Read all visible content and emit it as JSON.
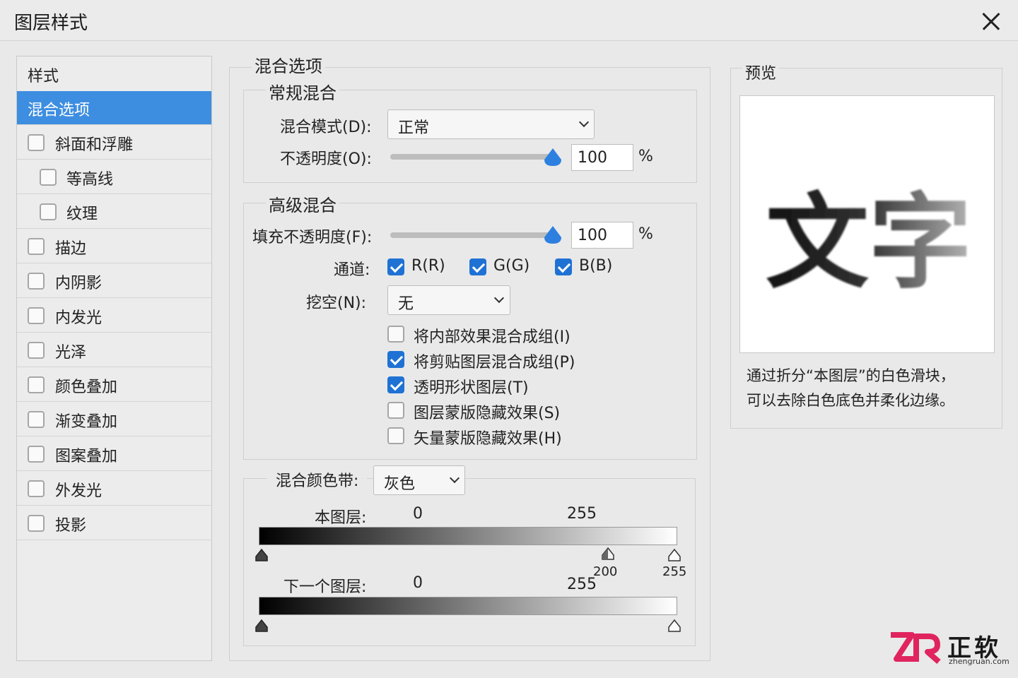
{
  "window": {
    "title": "图层样式"
  },
  "sidebar": {
    "header": "样式",
    "items": [
      {
        "label": "混合选项",
        "active": true,
        "checkbox": false
      },
      {
        "label": "斜面和浮雕",
        "checked": false
      },
      {
        "label": "等高线",
        "checked": false,
        "indent": true
      },
      {
        "label": "纹理",
        "checked": false,
        "indent": true
      },
      {
        "label": "描边",
        "checked": false
      },
      {
        "label": "内阴影",
        "checked": false
      },
      {
        "label": "内发光",
        "checked": false
      },
      {
        "label": "光泽",
        "checked": false
      },
      {
        "label": "颜色叠加",
        "checked": false
      },
      {
        "label": "渐变叠加",
        "checked": false
      },
      {
        "label": "图案叠加",
        "checked": false
      },
      {
        "label": "外发光",
        "checked": false
      },
      {
        "label": "投影",
        "checked": false
      }
    ]
  },
  "blend": {
    "title": "混合选项",
    "general": {
      "title": "常规混合",
      "mode_label": "混合模式(D):",
      "mode_value": "正常",
      "opacity_label": "不透明度(O):",
      "opacity_value": "100",
      "opacity_unit": "%",
      "opacity_fraction": 1.0
    },
    "advanced": {
      "title": "高级混合",
      "fill_label": "填充不透明度(F):",
      "fill_value": "100",
      "fill_unit": "%",
      "fill_fraction": 1.0,
      "channels_label": "通道:",
      "channel_r": "R(R)",
      "channel_g": "G(G)",
      "channel_b": "B(B)",
      "knockout_label": "挖空(N):",
      "knockout_value": "无",
      "options": [
        {
          "label": "将内部效果混合成组(I)",
          "checked": false
        },
        {
          "label": "将剪贴图层混合成组(P)",
          "checked": true
        },
        {
          "label": "透明形状图层(T)",
          "checked": true
        },
        {
          "label": "图层蒙版隐藏效果(S)",
          "checked": false
        },
        {
          "label": "矢量蒙版隐藏效果(H)",
          "checked": false
        }
      ]
    },
    "band": {
      "label": "混合颜色带:",
      "value": "灰色",
      "this_layer_label": "本图层:",
      "this_layer_min": "0",
      "this_layer_max": "255",
      "this_split_left": "200",
      "this_split_right": "255",
      "under_layer_label": "下一个图层:",
      "under_layer_min": "0",
      "under_layer_max": "255"
    }
  },
  "preview": {
    "title": "预览",
    "sample_text": "文字",
    "caption_line1": "通过折分“本图层”的白色滑块，",
    "caption_line2": "可以去除白色底色并柔化边缘。"
  },
  "watermark": {
    "brand": "正软",
    "url": "zhengruan.com"
  },
  "colors": {
    "accent": "#3d8ee0",
    "checkbox": "#1f72d4",
    "knob": "#2d80e0"
  }
}
